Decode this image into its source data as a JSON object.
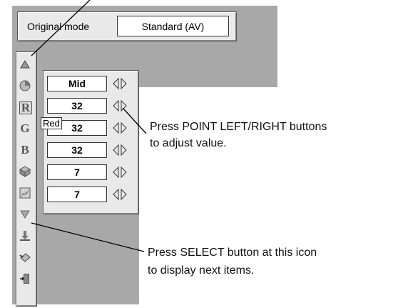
{
  "header": {
    "mode_label": "Original mode",
    "mode_value": "Standard (AV)"
  },
  "icons": [
    "contrast-icon",
    "color-circle-icon",
    "red-icon",
    "green-icon",
    "blue-icon",
    "sharpness-icon",
    "gamma-icon",
    "more-down-icon",
    "save-icon",
    "reset-icon",
    "exit-icon"
  ],
  "rows": [
    {
      "value": "Mid"
    },
    {
      "value": "32"
    },
    {
      "value": "32"
    },
    {
      "value": "32"
    },
    {
      "value": "7"
    },
    {
      "value": "7"
    }
  ],
  "tooltip": "Red",
  "icon_letters": {
    "r": "R",
    "g": "G",
    "b": "B"
  },
  "annotations": {
    "point_line1": "Press POINT LEFT/RIGHT buttons",
    "point_line2": "to adjust value.",
    "select_line1": "Press SELECT button at this icon",
    "select_line2": "to display next items."
  }
}
